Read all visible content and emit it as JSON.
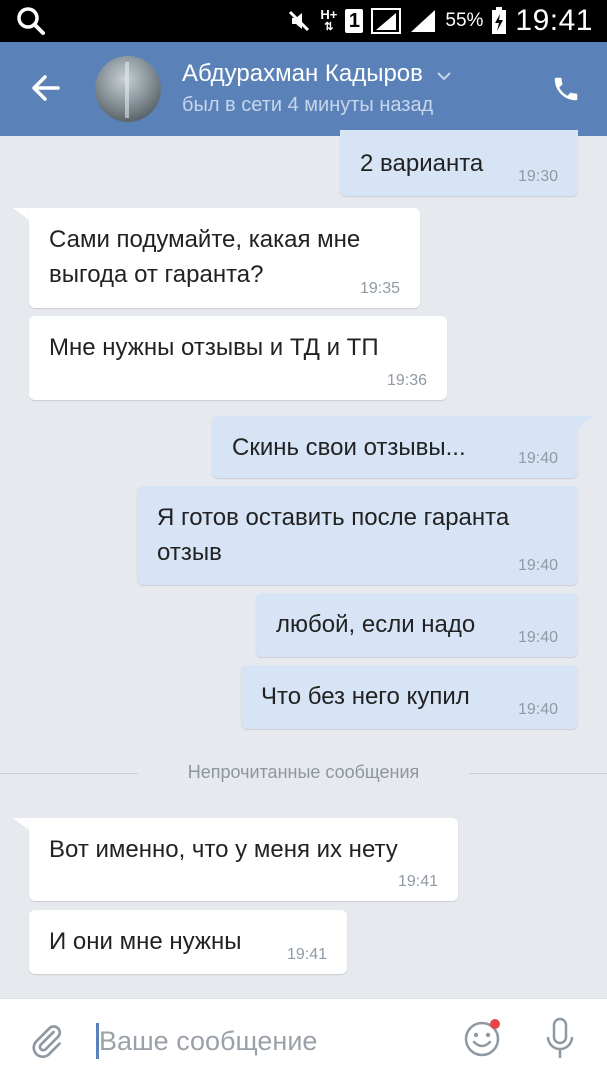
{
  "status_bar": {
    "network": "H+",
    "sim": "1",
    "battery": "55%",
    "time": "19:41",
    "icons": [
      "search-icon",
      "mute-icon",
      "network-hplus-icon",
      "sim-icon",
      "signal-icon",
      "signal-icon-2",
      "battery-icon"
    ]
  },
  "header": {
    "name": "Абдурахман Кадыров",
    "status": "был в сети 4 минуты назад",
    "accent_color": "#5b82b8"
  },
  "messages": [
    {
      "dir": "out",
      "text": "2 варианта",
      "time": "19:30"
    },
    {
      "dir": "in",
      "text": "Сами подумайте, какая мне\nвыгода от гаранта?",
      "time": "19:35"
    },
    {
      "dir": "in",
      "text": "Мне нужны отзывы и ТД и ТП",
      "time": "19:36"
    },
    {
      "dir": "out",
      "text": "Скинь свои отзывы...",
      "time": "19:40"
    },
    {
      "dir": "out",
      "text": "Я готов оставить после гаранта\nотзыв",
      "time": "19:40"
    },
    {
      "dir": "out",
      "text": "любой, если надо",
      "time": "19:40"
    },
    {
      "dir": "out",
      "text": "Что без него купил",
      "time": "19:40"
    },
    {
      "dir": "in",
      "text": "Вот именно, что у меня их нету",
      "time": "19:41"
    },
    {
      "dir": "in",
      "text": "И они мне нужны",
      "time": "19:41"
    }
  ],
  "divider": {
    "label": "Непрочитанные сообщения"
  },
  "composer": {
    "placeholder": "Ваше сообщение"
  }
}
